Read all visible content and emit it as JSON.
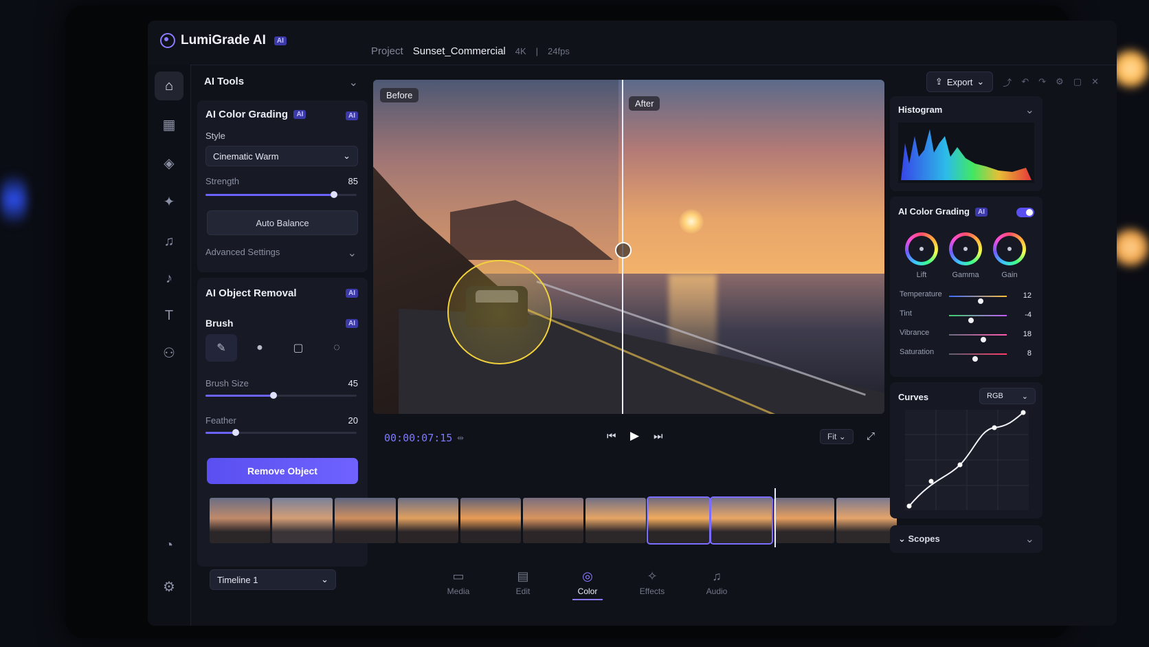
{
  "app": {
    "name": "LumiGrade AI",
    "ai_badge": "AI"
  },
  "project": {
    "label": "Project",
    "name": "Sunset_Commercial",
    "resolution": "4K",
    "separator": "|",
    "fps": "24fps"
  },
  "toolbar": {
    "export_label": "Export"
  },
  "left_panel": {
    "ai_tools": {
      "title": "AI Tools"
    },
    "color_grading": {
      "title": "AI Color Grading",
      "badge": "AI",
      "style_label": "Style",
      "style_value": "Cinematic Warm",
      "strength_label": "Strength",
      "strength_value": "85",
      "strength_level": 0.85,
      "auto_balance_label": "Auto Balance",
      "advanced_label": "Advanced Settings"
    },
    "object_removal": {
      "title": "AI Object Removal",
      "badge": "AI",
      "brush_label": "Brush",
      "brush_size_label": "Brush Size",
      "brush_size_value": "45",
      "brush_size_level": 0.45,
      "feather_label": "Feather",
      "feather_value": "20",
      "feather_level": 0.2,
      "remove_label": "Remove Object"
    }
  },
  "viewer": {
    "before_label": "Before",
    "after_label": "After"
  },
  "transport": {
    "timecode": "00:00:07:15",
    "fit_label": "Fit"
  },
  "timeline_selector": {
    "value": "Timeline 1"
  },
  "bottom_tabs": [
    {
      "label": "Media",
      "icon": "media-icon"
    },
    {
      "label": "Edit",
      "icon": "edit-icon"
    },
    {
      "label": "Color",
      "icon": "color-icon",
      "active": true
    },
    {
      "label": "Effects",
      "icon": "effects-icon"
    },
    {
      "label": "Audio",
      "icon": "audio-icon"
    }
  ],
  "right_panel": {
    "histogram": {
      "title": "Histogram"
    },
    "color_grading": {
      "title": "AI Color Grading",
      "badge": "AI",
      "enabled": true,
      "wheels": [
        "Lift",
        "Gamma",
        "Gain"
      ],
      "adjustments": [
        {
          "label": "Temperature",
          "value": "12",
          "level": 0.55
        },
        {
          "label": "Tint",
          "value": "-4",
          "level": 0.38
        },
        {
          "label": "Vibrance",
          "value": "18",
          "level": 0.6
        },
        {
          "label": "Saturation",
          "value": "8",
          "level": 0.45
        }
      ]
    },
    "curves": {
      "title": "Curves",
      "channel": "RGB"
    },
    "scopes": {
      "title": "Scopes"
    }
  },
  "colors": {
    "accent": "#6c63ff",
    "mask": "#f2d23c",
    "timecode": "#7d79ff"
  }
}
